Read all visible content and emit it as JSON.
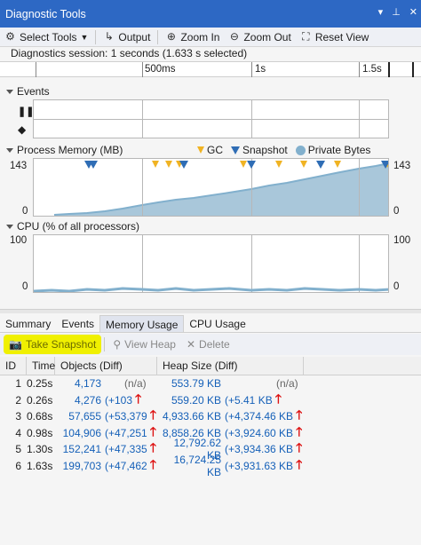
{
  "window": {
    "title": "Diagnostic Tools"
  },
  "toolbar": {
    "select_tools": "Select Tools",
    "output": "Output",
    "zoom_in": "Zoom In",
    "zoom_out": "Zoom Out",
    "reset_view": "Reset View"
  },
  "session": {
    "text": "Diagnostics session: 1 seconds (1.633 s selected)"
  },
  "ruler": {
    "labels": [
      "500ms",
      "1s",
      "1.5s"
    ]
  },
  "events": {
    "title": "Events"
  },
  "memory": {
    "title": "Process Memory (MB)",
    "ymax": "143",
    "ymin": "0",
    "legend": {
      "gc": "GC",
      "snapshot": "Snapshot",
      "private_bytes": "Private Bytes"
    }
  },
  "cpu": {
    "title": "CPU (% of all processors)",
    "ymax": "100",
    "ymin": "0"
  },
  "tabs": [
    "Summary",
    "Events",
    "Memory Usage",
    "CPU Usage"
  ],
  "actions": {
    "take_snapshot": "Take Snapshot",
    "view_heap": "View Heap",
    "delete": "Delete"
  },
  "table": {
    "headers": [
      "ID",
      "Time",
      "Objects (Diff)",
      "Heap Size (Diff)"
    ],
    "rows": [
      {
        "id": "1",
        "time": "0.25s",
        "objects": "4,173",
        "obj_diff": "(n/a)",
        "heap": "553.79 KB",
        "heap_diff": "(n/a)"
      },
      {
        "id": "2",
        "time": "0.26s",
        "objects": "4,276",
        "obj_diff": "(+103",
        "heap": "559.20 KB",
        "heap_diff": "(+5.41 KB"
      },
      {
        "id": "3",
        "time": "0.68s",
        "objects": "57,655",
        "obj_diff": "(+53,379",
        "heap": "4,933.66 KB",
        "heap_diff": "(+4,374.46 KB"
      },
      {
        "id": "4",
        "time": "0.98s",
        "objects": "104,906",
        "obj_diff": "(+47,251",
        "heap": "8,858.26 KB",
        "heap_diff": "(+3,924.60 KB"
      },
      {
        "id": "5",
        "time": "1.30s",
        "objects": "152,241",
        "obj_diff": "(+47,335",
        "heap": "12,792.62 KB",
        "heap_diff": "(+3,934.36 KB"
      },
      {
        "id": "6",
        "time": "1.63s",
        "objects": "199,703",
        "obj_diff": "(+47,462",
        "heap": "16,724.25 KB",
        "heap_diff": "(+3,931.63 KB"
      }
    ]
  },
  "colors": {
    "title_bar": "#2d68c4",
    "memory_fill": "#82b0cd",
    "gc": "#f0b323",
    "snapshot": "#2f6db5",
    "link": "#1560b8",
    "highlight": "#f0f000"
  }
}
